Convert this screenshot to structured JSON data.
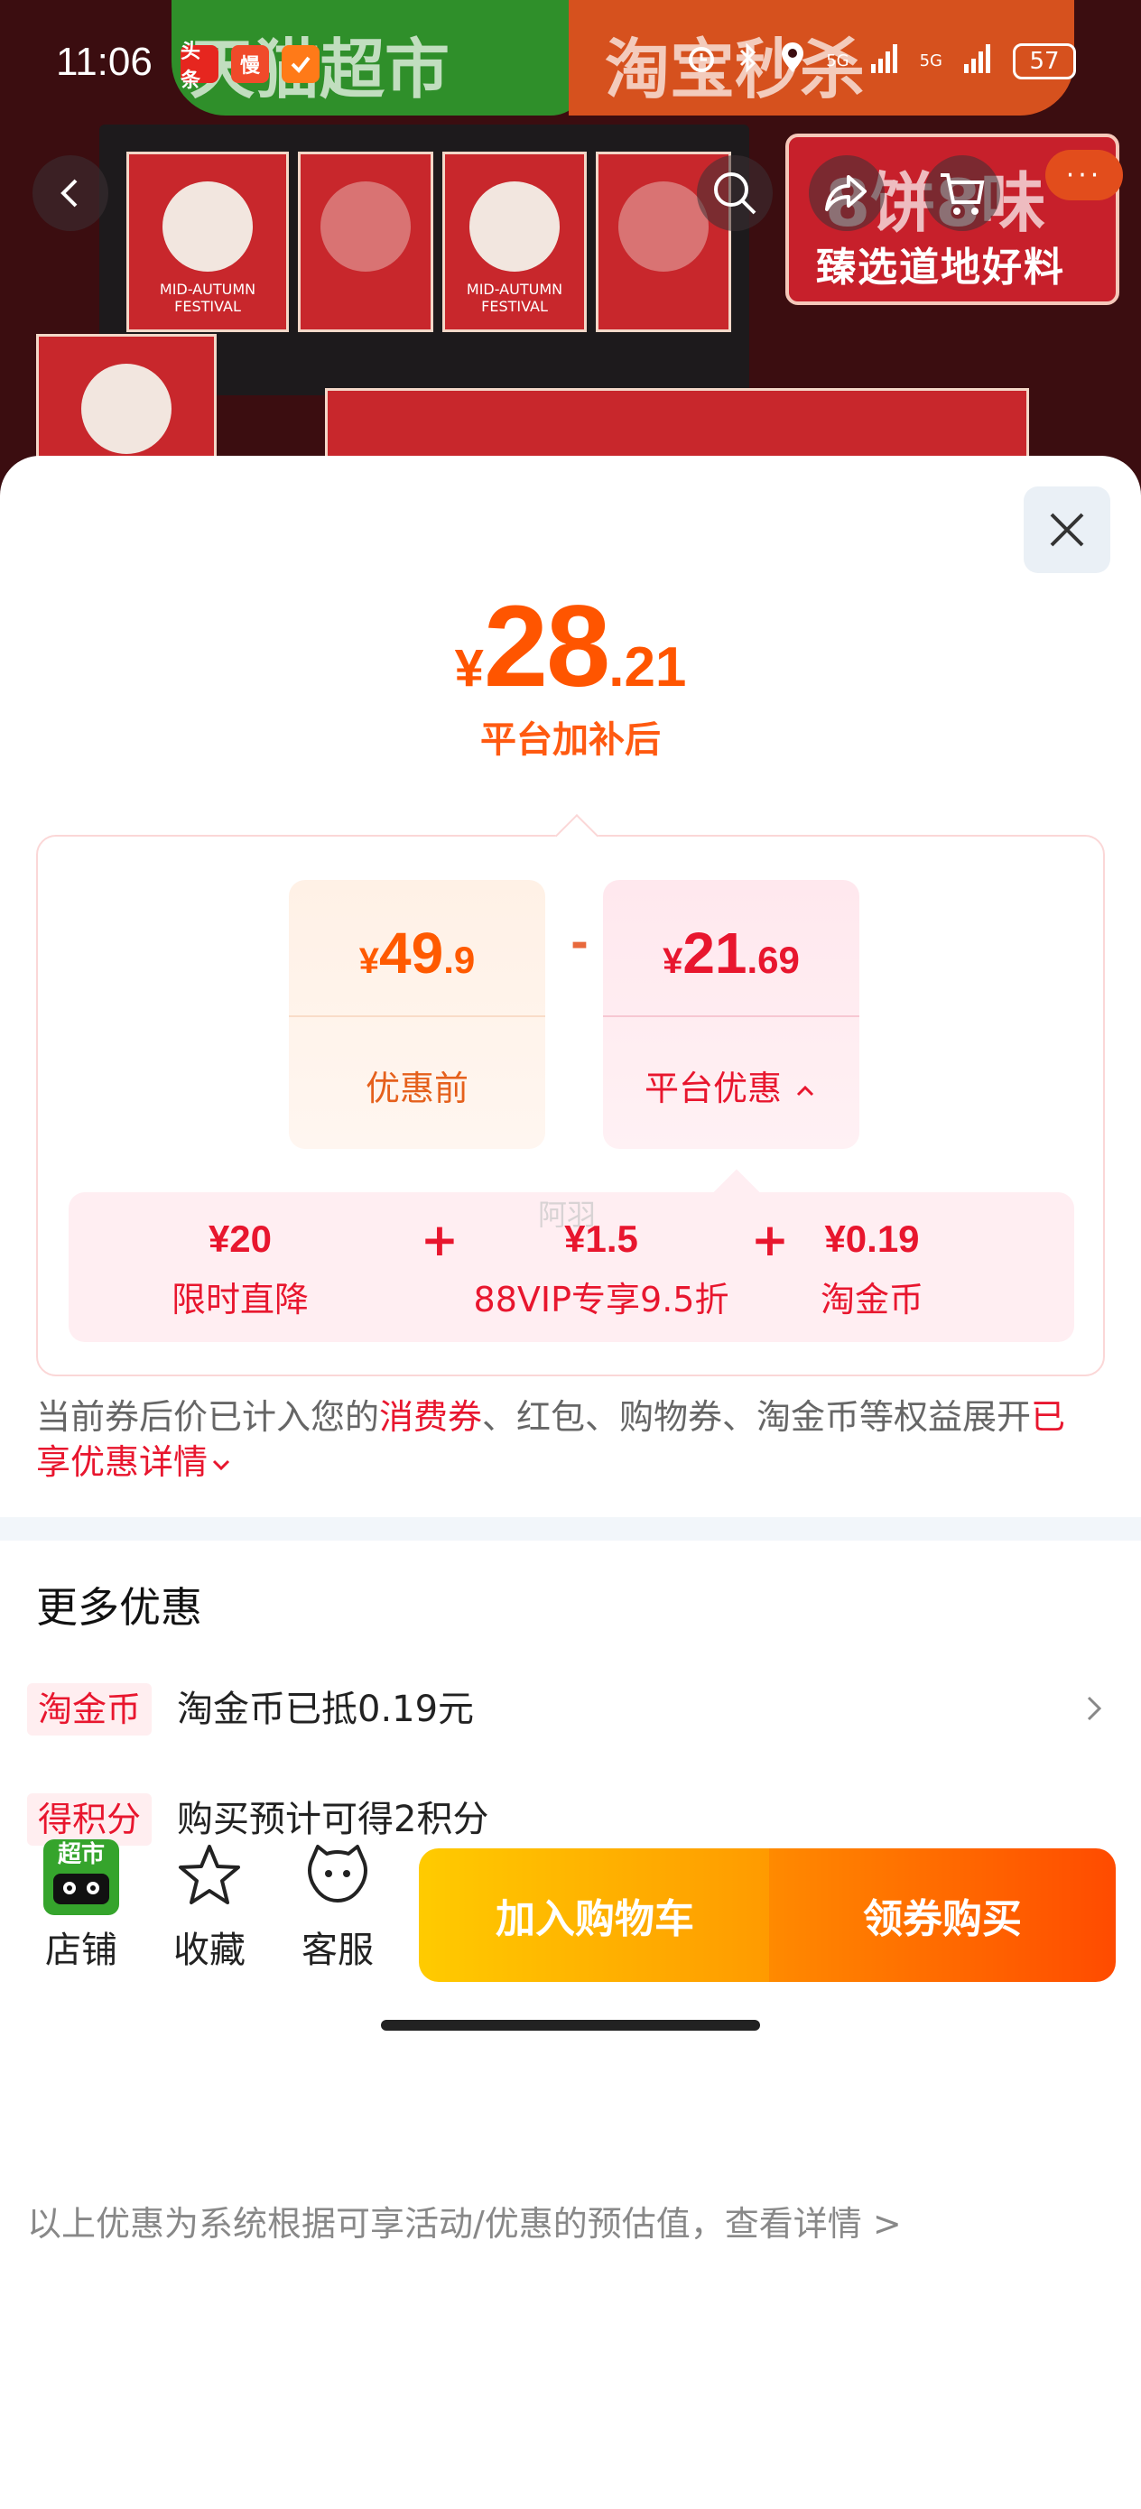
{
  "status_bar": {
    "time": "11:06",
    "apps": [
      "头条",
      "慢",
      ""
    ],
    "signal1": "5G",
    "signal2": "5G",
    "battery": "57"
  },
  "background": {
    "banner_left": "天猫超市",
    "banner_right": "淘宝秒杀",
    "sign_title": "8饼8味",
    "sign_sub": "臻选道地好料",
    "box_caption": "MID-AUTUMN FESTIVAL",
    "watermark": "阿羽"
  },
  "price": {
    "symbol": "¥",
    "integer": "28",
    "decimal": ".21",
    "caption": "平台加补后"
  },
  "calc": {
    "original": {
      "symbol": "¥",
      "integer": "49",
      "decimal": ".9",
      "label": "优惠前"
    },
    "operator": "-",
    "platform": {
      "symbol": "¥",
      "integer": "21",
      "decimal": ".69",
      "label": "平台优惠"
    },
    "breakdown": [
      {
        "value": "¥20",
        "name": "限时直降"
      },
      {
        "value": "¥1.5",
        "name": "88VIP专享9.5折"
      },
      {
        "value": "¥0.19",
        "name": "淘金币"
      }
    ],
    "plus": "+"
  },
  "note": {
    "part1": "当前券后价已计入您的",
    "highlight": "消费券",
    "part2": "、红包、购物券、淘金币等权益展开",
    "link": "已享优惠详情"
  },
  "more": {
    "title": "更多优惠",
    "items": [
      {
        "tag": "淘金币",
        "text": "淘金币已抵0.19元"
      },
      {
        "tag": "得积分",
        "text": "购买预计可得2积分"
      }
    ]
  },
  "disclaimer": "以上优惠为系统根据可享活动/优惠的预估值，查看详情 >",
  "bottom_bar": {
    "shop_logo": "超市",
    "shop": "店铺",
    "favorite": "收藏",
    "service": "客服",
    "add_cart": "加入购物车",
    "buy": "领券购买"
  }
}
